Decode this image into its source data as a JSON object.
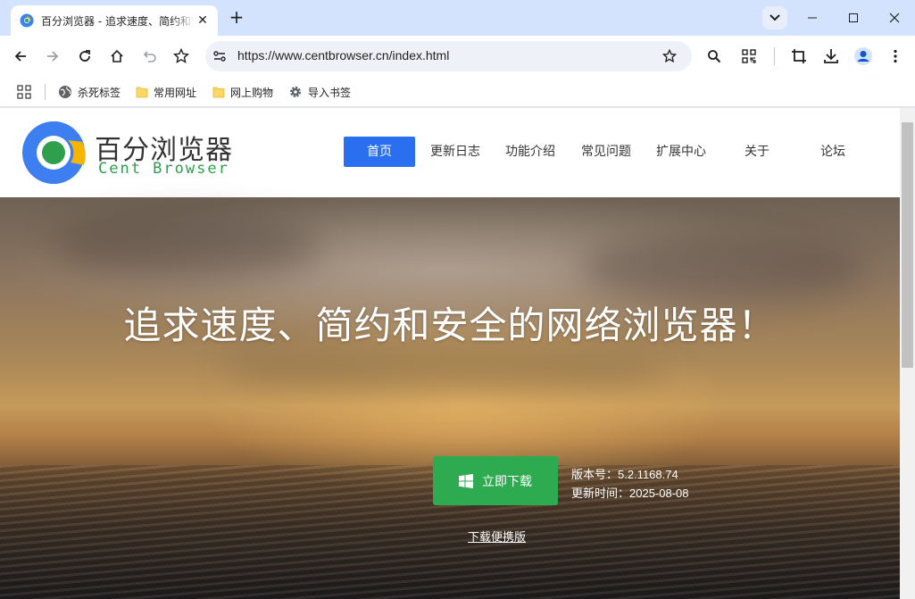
{
  "tab": {
    "title": "百分浏览器 - 追求速度、简约和安全的网络浏览器！"
  },
  "toolbar": {
    "url": "https://www.centbrowser.cn/index.html"
  },
  "bookmarks": [
    {
      "label": "杀死标签",
      "icon": "globe-icon"
    },
    {
      "label": "常用网址",
      "icon": "folder-icon"
    },
    {
      "label": "网上购物",
      "icon": "folder-icon"
    },
    {
      "label": "导入书签",
      "icon": "gear-icon"
    }
  ],
  "site": {
    "logo_title": "百分浏览器",
    "logo_subtitle": "Cent Browser",
    "nav": [
      "首页",
      "更新日志",
      "功能介绍",
      "常见问题",
      "扩展中心",
      "关于",
      "论坛"
    ],
    "slogan": "追求速度、简约和安全的网络浏览器！",
    "download_label": "立即下载",
    "version_text": "版本号：5.2.1168.74",
    "update_text": "更新时间：2025-08-08",
    "portable_label": "下载便携版"
  },
  "colors": {
    "accent": "#2a6ff0",
    "download_green": "#2eab51",
    "tabstrip": "#d3e3fd",
    "logo_green": "#2f9e4d"
  }
}
